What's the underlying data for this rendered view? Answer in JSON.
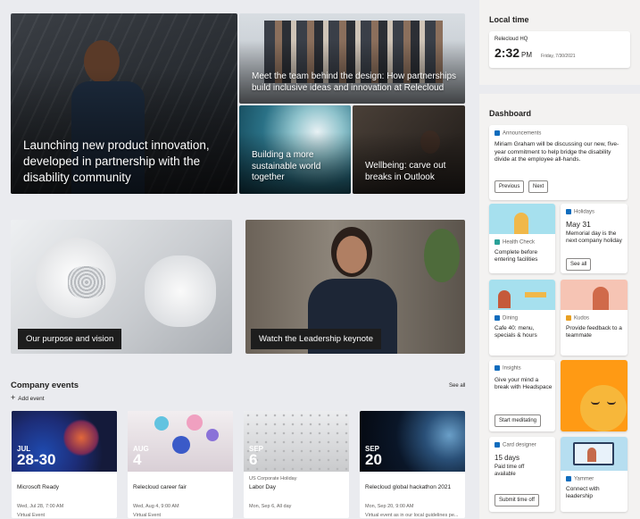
{
  "hero": {
    "main_caption": "Launching new product innovation, developed in partnership with the disability community",
    "team_caption": "Meet the team behind the design: How partnerships build inclusive ideas and innovation at Relecloud",
    "sustain_caption": "Building a more sustainable world together",
    "wellbeing_caption": "Wellbeing: carve out breaks in Outlook"
  },
  "promos": {
    "purpose_label": "Our purpose and vision",
    "keynote_label": "Watch the Leadership keynote"
  },
  "events": {
    "title": "Company events",
    "add_label": "Add event",
    "see_all": "See all",
    "items": [
      {
        "month": "JUL",
        "day": "28-30",
        "title": "Microsoft Ready",
        "date": "Wed, Jul 28, 7:00 AM",
        "loc": "Virtual Event"
      },
      {
        "month": "AUG",
        "day": "4",
        "title": "Relecloud career fair",
        "date": "Wed, Aug 4, 9:00 AM",
        "loc": "Virtual Event"
      },
      {
        "month": "SEP",
        "day": "6",
        "pre": "US Corporate Holiday",
        "title": "Labor Day",
        "date": "Mon, Sep 6, All day",
        "loc": ""
      },
      {
        "month": "SEP",
        "day": "20",
        "title": "Relecloud global hackathon 2021",
        "date": "Mon, Sep 20, 9:00 AM",
        "loc": "Virtual event as in our local guidelines pe..."
      }
    ]
  },
  "local_time": {
    "title": "Local time",
    "location": "Relecloud HQ",
    "time": "2:32",
    "ampm": "PM",
    "date": "Friday, 7/30/2021"
  },
  "dashboard": {
    "title": "Dashboard",
    "announcements": {
      "label": "Announcements",
      "text": "Miriam Graham will be discussing our new, five-year commitment to help bridge the disability divide at the employee all-hands.",
      "prev": "Previous",
      "next": "Next"
    },
    "health": {
      "label": "Health Check",
      "text": "Complete before entering facilities"
    },
    "holidays": {
      "label": "Holidays",
      "date": "May 31",
      "text": "Memorial day is the next company holiday",
      "btn": "See all"
    },
    "dining": {
      "label": "Dining",
      "text": "Cafe 40: menu, specials & hours"
    },
    "kudos": {
      "label": "Kudos",
      "text": "Provide feedback to a teammate"
    },
    "insights": {
      "label": "Insights",
      "text": "Give your mind a break with Headspace",
      "btn": "Start meditating"
    },
    "card_designer": {
      "label": "Card designer",
      "value": "15 days",
      "text": "Paid time off available",
      "btn": "Submit time off"
    },
    "yammer": {
      "label": "Yammer",
      "text": "Connect with leadership"
    }
  },
  "colors": {
    "accent": "#0f6cbd",
    "headspace": "#ff9a14"
  }
}
